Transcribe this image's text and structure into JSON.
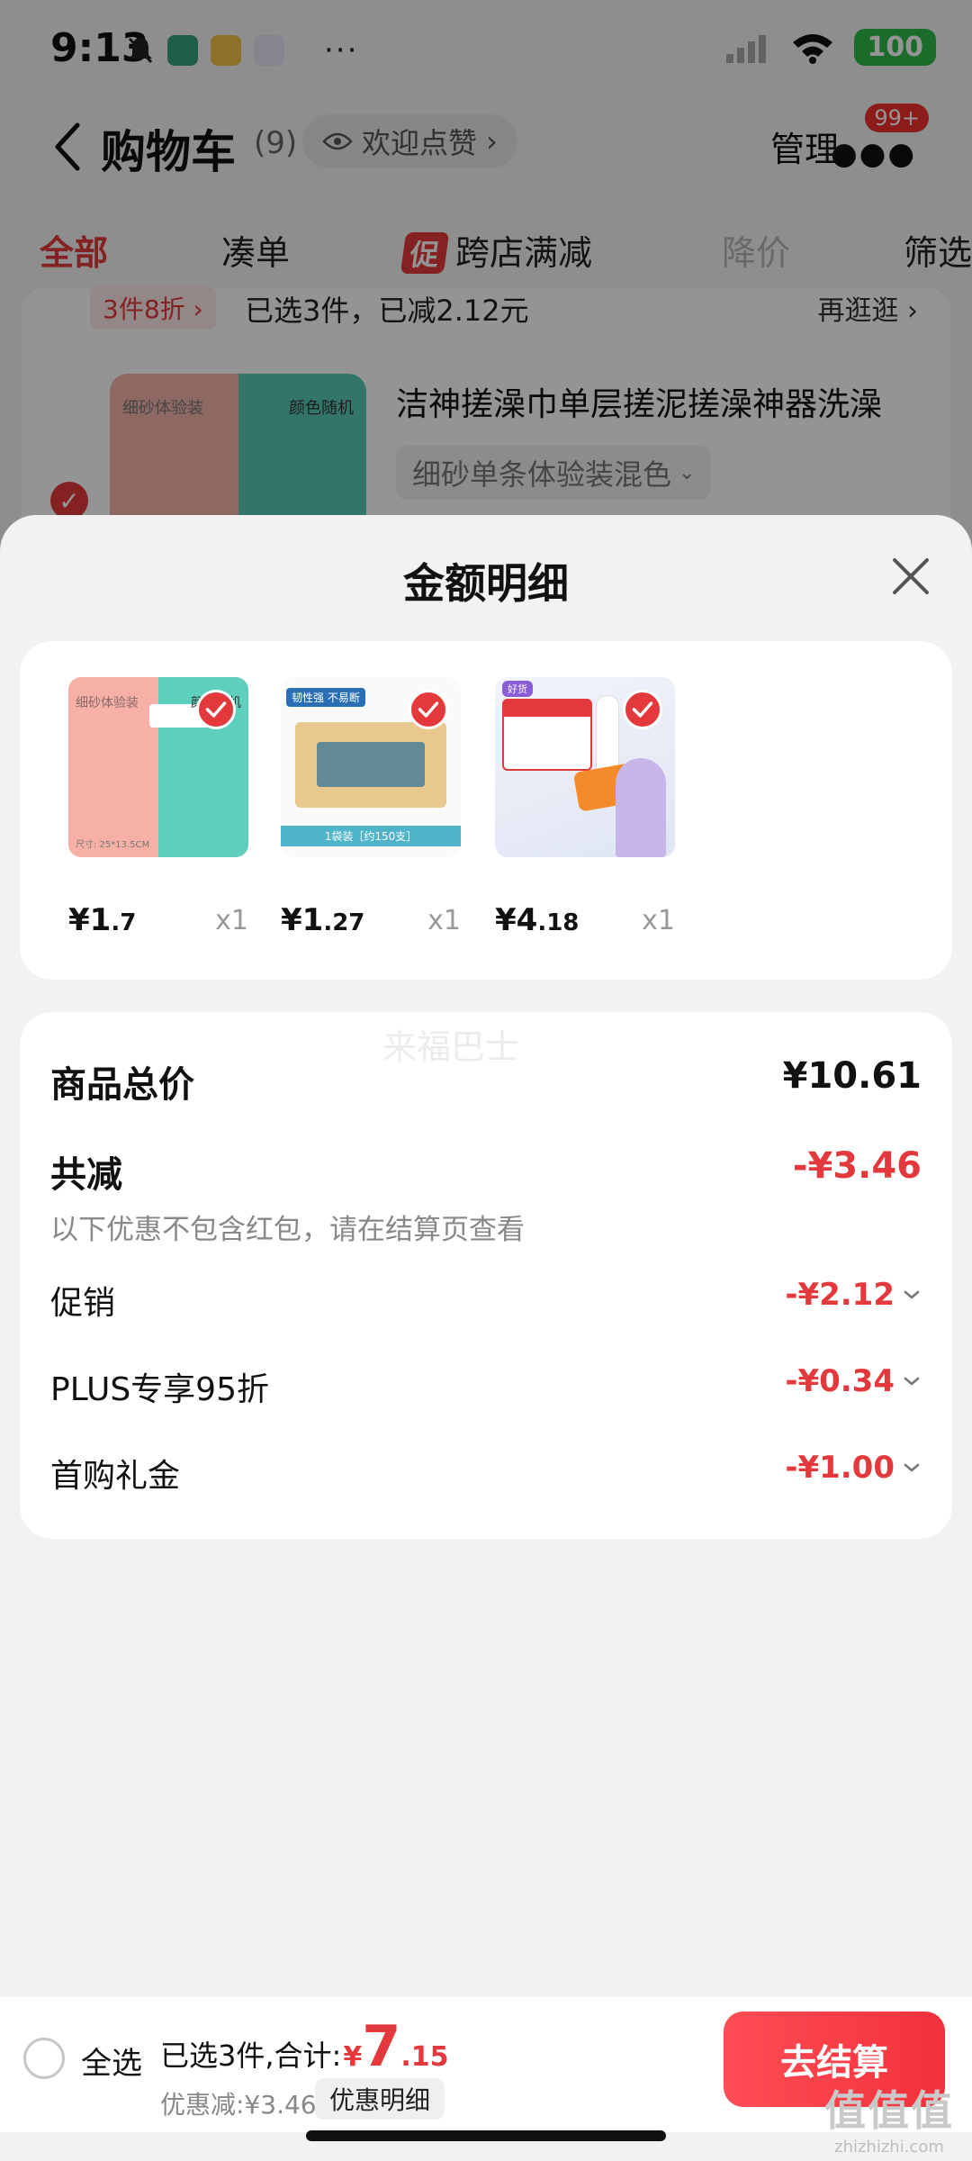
{
  "status_bar": {
    "time": "9:13",
    "more": "···",
    "battery": "100"
  },
  "header": {
    "title": "购物车",
    "count": "(9)",
    "welcome": "欢迎点赞",
    "manage": "管理",
    "badge": "99+"
  },
  "tabs": [
    {
      "label": "全部"
    },
    {
      "label": "凑单"
    },
    {
      "label": "跨店满减",
      "badge": "促"
    },
    {
      "label": "降价"
    },
    {
      "label": "筛选"
    }
  ],
  "promo": {
    "tag": "3件8折 ›",
    "text": "已选3件，已减2.12元",
    "more": "再逛逛 ›"
  },
  "bg_item": {
    "title": "洁神搓澡巾单层搓泥搓澡神器洗澡",
    "spec": "细砂单条体验装混色",
    "img_label_left": "细砂体验装",
    "img_label_right": "颜色随机"
  },
  "sheet": {
    "title": "金额明细",
    "items": [
      {
        "price_int": "¥1",
        "price_dec": ".7",
        "qty": "x1",
        "img_label_left": "细砂体验装",
        "img_label_right": "颜色随机",
        "img_foot": "尺寸: 25*13.5CM"
      },
      {
        "price_int": "¥1",
        "price_dec": ".27",
        "qty": "x1",
        "img_tag": "韧性强 不易断",
        "img_foot": "1袋装［约150支］"
      },
      {
        "price_int": "¥4",
        "price_dec": ".18",
        "qty": "x1",
        "img_tag": "好货"
      }
    ],
    "watermark": "来福巴士",
    "total_label": "商品总价",
    "total_value": "¥10.61",
    "reduce_label": "共减",
    "reduce_value": "-¥3.46",
    "reduce_note": "以下优惠不包含红包，请在结算页查看",
    "discounts": [
      {
        "label": "促销",
        "value": "-¥2.12"
      },
      {
        "label": "PLUS专享95折",
        "value": "-¥0.34"
      },
      {
        "label": "首购礼金",
        "value": "-¥1.00"
      }
    ]
  },
  "bottom": {
    "select_all": "全选",
    "sum_prefix": "已选3件,合计:",
    "sum_yen": "¥",
    "sum_int": "7",
    "sum_dec": ".15",
    "discount_text": "优惠减:¥3.46",
    "detail_pill": "优惠明细",
    "checkout": "去结算"
  },
  "corner_watermark": {
    "big": "值值值",
    "small": "zhizhizhi.com"
  },
  "colors": {
    "accent": "#e4393c",
    "battery": "#2fb84a"
  }
}
